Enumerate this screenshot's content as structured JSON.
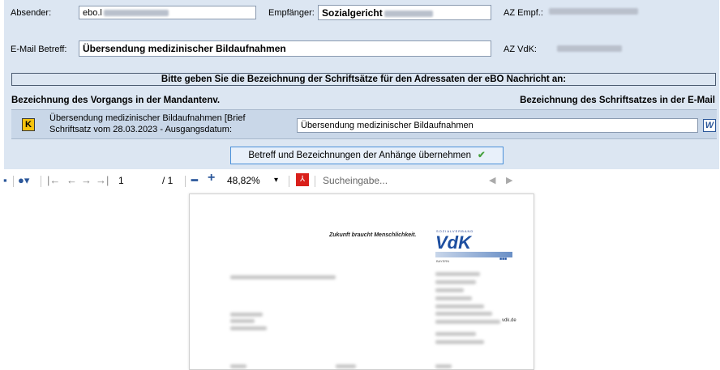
{
  "form": {
    "absender_label": "Absender:",
    "absender_value": "ebo.l",
    "empfaenger_label": "Empfänger:",
    "empfaenger_value": "Sozialgericht",
    "az_empf_label": "AZ Empf.:",
    "email_betreff_label": "E-Mail Betreff:",
    "email_betreff_value": "Übersendung medizinischer Bildaufnahmen",
    "az_vdk_label": "AZ VdK:",
    "banner": "Bitte geben Sie die Bezeichnung der Schriftsätze für den Adressaten der eBO Nachricht an:",
    "col_left": "Bezeichnung des Vorgangs in der Mandantenv.",
    "col_right": "Bezeichnung des Schriftsatzes in der E-Mail",
    "row": {
      "k_icon": "K",
      "desc_line1": "Übersendung medizinischer Bildaufnahmen  [Brief",
      "desc_line2": "Schriftsatz vom 28.03.2023 - Ausgangsdatum:",
      "subject": "Übersendung medizinischer Bildaufnahmen",
      "w_icon": "W"
    },
    "apply_button": "Betreff und Bezeichnungen der Anhänge übernehmen"
  },
  "toolbar": {
    "page_current": "1",
    "page_total": "/ 1",
    "zoom": "48,82%",
    "search_placeholder": "Sucheingabe..."
  },
  "document": {
    "slogan": "Zukunft braucht Menschlichkeit.",
    "logo_top": "SOZIALVERBAND",
    "logo": "VdK",
    "logo_region": "BAYERN",
    "web_suffix": "vdk.de"
  },
  "colors": {
    "form_bg": "#dce6f2",
    "accent": "#4a90d9",
    "pdf_red": "#d9201b",
    "vdk_blue": "#1e4fa0"
  }
}
